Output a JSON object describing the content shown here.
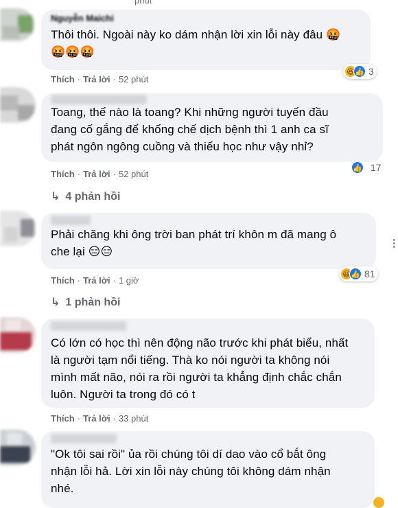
{
  "comments": [
    {
      "author": "Nguyễn Maichi",
      "text": "Thôi thôi. Ngoài này ko dám nhận lời xin lỗi này đâu 🤬\n🤬🤬🤬",
      "like": "Thích",
      "reply": "Trả lời",
      "time": "52 phút",
      "reactions": "3",
      "reaction_icons": [
        "haha-icon",
        "like-icon"
      ]
    },
    {
      "author": "",
      "text": "Toang, thế nào là toang? Khi những người tuyến đầu\nđang cố gắng để khống chế dịch bệnh thì 1 anh ca sĩ\nphát ngôn ngông cuồng và thiếu học như vậy nhỉ?",
      "like": "Thích",
      "reply": "Trả lời",
      "time": "52 phút",
      "reactions": "17",
      "reaction_icons": [
        "like-icon"
      ],
      "replies": "4 phản hồi"
    },
    {
      "author": "",
      "text": "Phải chăng khi ông trời ban phát trí khôn m đã mang ô\nche lại 😑😑",
      "like": "Thích",
      "reply": "Trả lời",
      "time": "1 giờ",
      "reactions": "81",
      "reaction_icons": [
        "haha-icon",
        "like-icon"
      ],
      "replies": "1 phản hồi"
    },
    {
      "author": "",
      "text": "Có lớn có học thì nên động não trước khi phát biểu, nhất\nlà người tạm nổi tiếng. Thà ko nói người ta không nói\nmình mất não, nói ra rồi người ta khẳng định chắc chắn\nluôn. Người ta trong đó có t",
      "like": "Thích",
      "reply": "Trả lời",
      "time": "33 phút"
    },
    {
      "author": "",
      "text": "\"Ok tôi sai rồi\" ủa rồi chúng tôi dí dao vào cổ bắt ông\nnhận lỗi hả. Lời xin lỗi này chúng tôi không dám nhận\nnhé."
    }
  ],
  "top_time": "phút",
  "colors": {
    "bubble": "#f0f2f5",
    "meta": "#65676b",
    "like": "#1877f2",
    "haha": "#f7b125"
  }
}
